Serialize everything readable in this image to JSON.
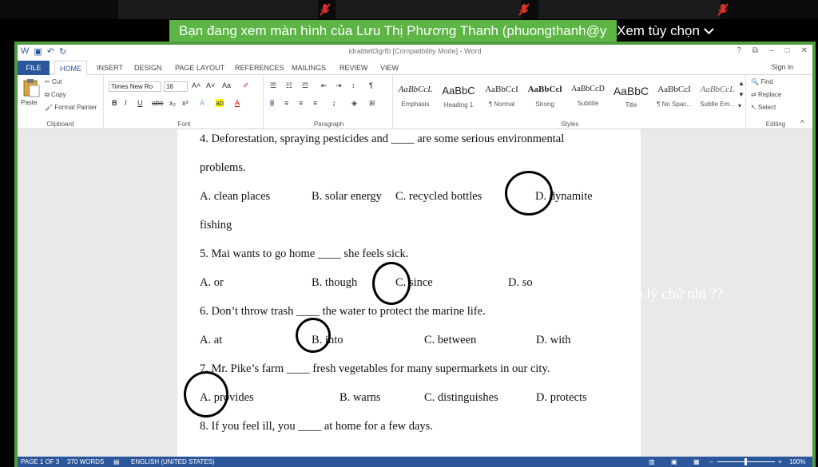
{
  "zoom": {
    "share_banner": "Bạn đang xem màn hình của Lưu Thị Phương Thanh (phuongthanh@y",
    "view_options": "Xem tùy chọn"
  },
  "word": {
    "title": "idraittett3grfb [Compatibility Mode] - Word",
    "window_controls": [
      "?",
      "⧉",
      "–",
      "□",
      "✕"
    ],
    "signin": "Sign in",
    "tabs": [
      "FILE",
      "HOME",
      "INSERT",
      "DESIGN",
      "PAGE LAYOUT",
      "REFERENCES",
      "MAILINGS",
      "REVIEW",
      "VIEW"
    ],
    "clipboard": {
      "paste": "Paste",
      "cut": "Cut",
      "copy": "Copy",
      "format_painter": "Format Painter",
      "label": "Clipboard"
    },
    "font": {
      "name": "Times New Ro",
      "size": "16",
      "label": "Font"
    },
    "paragraph": {
      "label": "Paragraph"
    },
    "styles": {
      "label": "Styles",
      "items": [
        {
          "sample": "AaBbCcL",
          "name": "Emphasis"
        },
        {
          "sample": "AaBbC",
          "name": "Heading 1"
        },
        {
          "sample": "AaBbCcI",
          "name": "¶ Normal"
        },
        {
          "sample": "AaBbCcl",
          "name": "Strong"
        },
        {
          "sample": "AaBbCcD",
          "name": "Subtitle"
        },
        {
          "sample": "AaBbC",
          "name": "Title"
        },
        {
          "sample": "AaBbCcI",
          "name": "¶ No Spac..."
        },
        {
          "sample": "AaBbCcL",
          "name": "Subtle Em..."
        }
      ]
    },
    "editing": {
      "find": "Find",
      "replace": "Replace",
      "select": "Select",
      "label": "Editing"
    },
    "document": {
      "q4_text": "4. Deforestation, spraying pesticides and ____ are some serious environmental",
      "q4_cont": "problems.",
      "q4_a": "A. clean places",
      "q4_b": "B. solar energy",
      "q4_c": "C. recycled bottles",
      "q4_d": "D. dynamite",
      "q4_d_cont": "fishing",
      "q5_text": "5. Mai wants to go home ____ she feels sick.",
      "q5_a": "A. or",
      "q5_b": "B. though",
      "q5_c": "C. since",
      "q5_d": "D. so",
      "q6_text": "6. Don’t throw trash ____ the water to protect the marine life.",
      "q6_a": "A. at",
      "q6_b": "B. into",
      "q6_c": "C. between",
      "q6_d": "D. with",
      "q7_text": "7. Mr. Pike’s farm ____ fresh vegetables for many supermarkets in our city.",
      "q7_a": "A. provides",
      "q7_b": "B. warns",
      "q7_c": "C. distinguishes",
      "q7_d": "D. protects",
      "q8_text": "8. If you feel ill, you ____ at home for a few days."
    },
    "status": {
      "page": "PAGE 1 OF 3",
      "words": "370 WORDS",
      "language": "ENGLISH (UNITED STATES)",
      "zoom": "100%"
    }
  },
  "comment": "into mới hợp lý chứ nhỉ ??",
  "colors": {
    "banner": "#5cb544",
    "word_blue": "#2b579a",
    "frame_green": "#4f9d3f"
  }
}
